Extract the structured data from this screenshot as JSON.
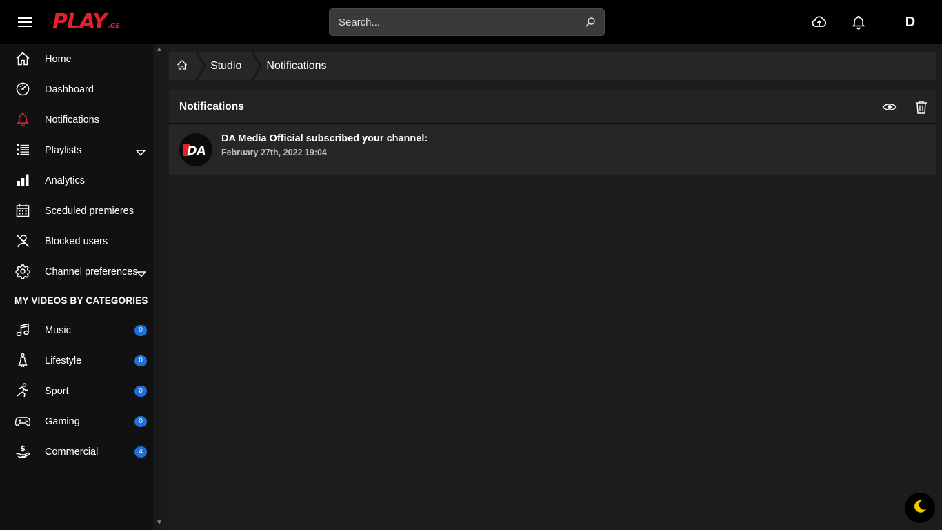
{
  "header": {
    "logo_main": "PLAY",
    "logo_sub": ".GE",
    "search_placeholder": "Search...",
    "avatar_letter": "D"
  },
  "sidebar": {
    "items": [
      {
        "label": "Home",
        "icon": "home-icon"
      },
      {
        "label": "Dashboard",
        "icon": "speedometer-icon"
      },
      {
        "label": "Notifications",
        "icon": "bell-icon",
        "active": true,
        "active_color": "#e4202a"
      },
      {
        "label": "Playlists",
        "icon": "list-icon",
        "has_caret": true
      },
      {
        "label": "Analytics",
        "icon": "bar-chart-icon"
      },
      {
        "label": "Sceduled premieres",
        "icon": "calendar-icon"
      },
      {
        "label": "Blocked users",
        "icon": "blocked-user-icon"
      },
      {
        "label": "Channel preferences",
        "icon": "gear-icon",
        "has_caret": true
      }
    ],
    "section_title": "MY VIDEOS BY CATEGORIES",
    "categories": [
      {
        "label": "Music",
        "icon": "music-note-icon",
        "count": "0"
      },
      {
        "label": "Lifestyle",
        "icon": "person-icon",
        "count": "0"
      },
      {
        "label": "Sport",
        "icon": "running-icon",
        "count": "0"
      },
      {
        "label": "Gaming",
        "icon": "gamepad-icon",
        "count": "0"
      },
      {
        "label": "Commercial",
        "icon": "money-hand-icon",
        "count": "4"
      }
    ]
  },
  "breadcrumb": {
    "items": [
      "Studio",
      "Notifications"
    ]
  },
  "notifications": {
    "title": "Notifications",
    "list": [
      {
        "avatar_text": "DA",
        "message": "DA Media Official subscribed your channel:",
        "time": "February 27th, 2022 19:04"
      }
    ]
  },
  "colors": {
    "brand": "#e4202a",
    "badge": "#1f6fd6",
    "moon": "#f5c400"
  }
}
